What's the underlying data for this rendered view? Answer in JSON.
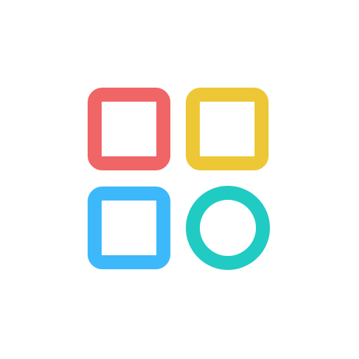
{
  "icon": {
    "name": "app-grid-icon",
    "shapes": [
      {
        "name": "red-square-icon",
        "kind": "rounded-square",
        "color": "#F06565"
      },
      {
        "name": "yellow-square-icon",
        "kind": "rounded-square",
        "color": "#EDC735"
      },
      {
        "name": "blue-square-icon",
        "kind": "rounded-square",
        "color": "#3DB9FB"
      },
      {
        "name": "teal-circle-icon",
        "kind": "circle",
        "color": "#20CBC3"
      }
    ],
    "background": "#FFFFFF"
  }
}
